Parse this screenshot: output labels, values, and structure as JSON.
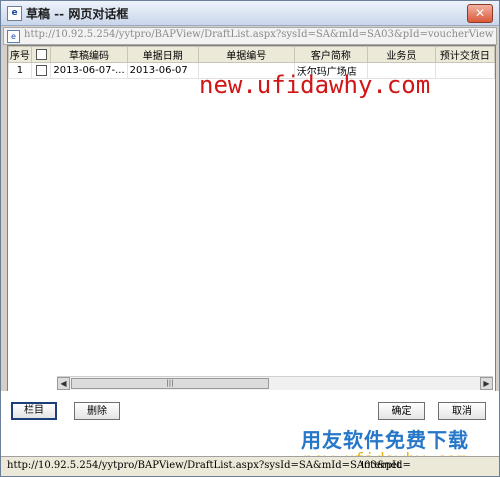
{
  "window": {
    "title": "草稿 -- 网页对话框",
    "close_glyph": "✕",
    "app_icon_glyph": "e"
  },
  "address": {
    "page_icon_glyph": "e",
    "url": "http://10.92.5.254/yytpro/BAPView/DraftList.aspx?sysId=SA&mId=SA03&pId=voucherView&TemplateNam..."
  },
  "grid": {
    "columns": [
      "序号",
      "",
      "草稿编码",
      "单据日期",
      "单据编号",
      "客户简称",
      "业务员",
      "预计交货日"
    ],
    "rows": [
      {
        "seq": "1",
        "draft_code": "2013-06-07-...",
        "doc_date": "2013-06-07",
        "doc_no": "",
        "customer": "沃尔玛广场店",
        "salesman": "",
        "delivery": ""
      }
    ]
  },
  "scrollbar": {
    "left_glyph": "◀",
    "right_glyph": "▶",
    "thumb_glyph": "|||"
  },
  "buttons": {
    "columns": "栏目",
    "delete": "删除",
    "ok": "确定",
    "cancel": "取消"
  },
  "watermarks": {
    "top": "new.ufidawhy.com",
    "cn": "用友软件免费下载",
    "bottom": "new.ufidawhy.com"
  },
  "status": {
    "url": "http://10.92.5.254/yytpro/BAPView/DraftList.aspx?sysId=SA&mId=SA03&pId=",
    "zone": "Internet"
  }
}
